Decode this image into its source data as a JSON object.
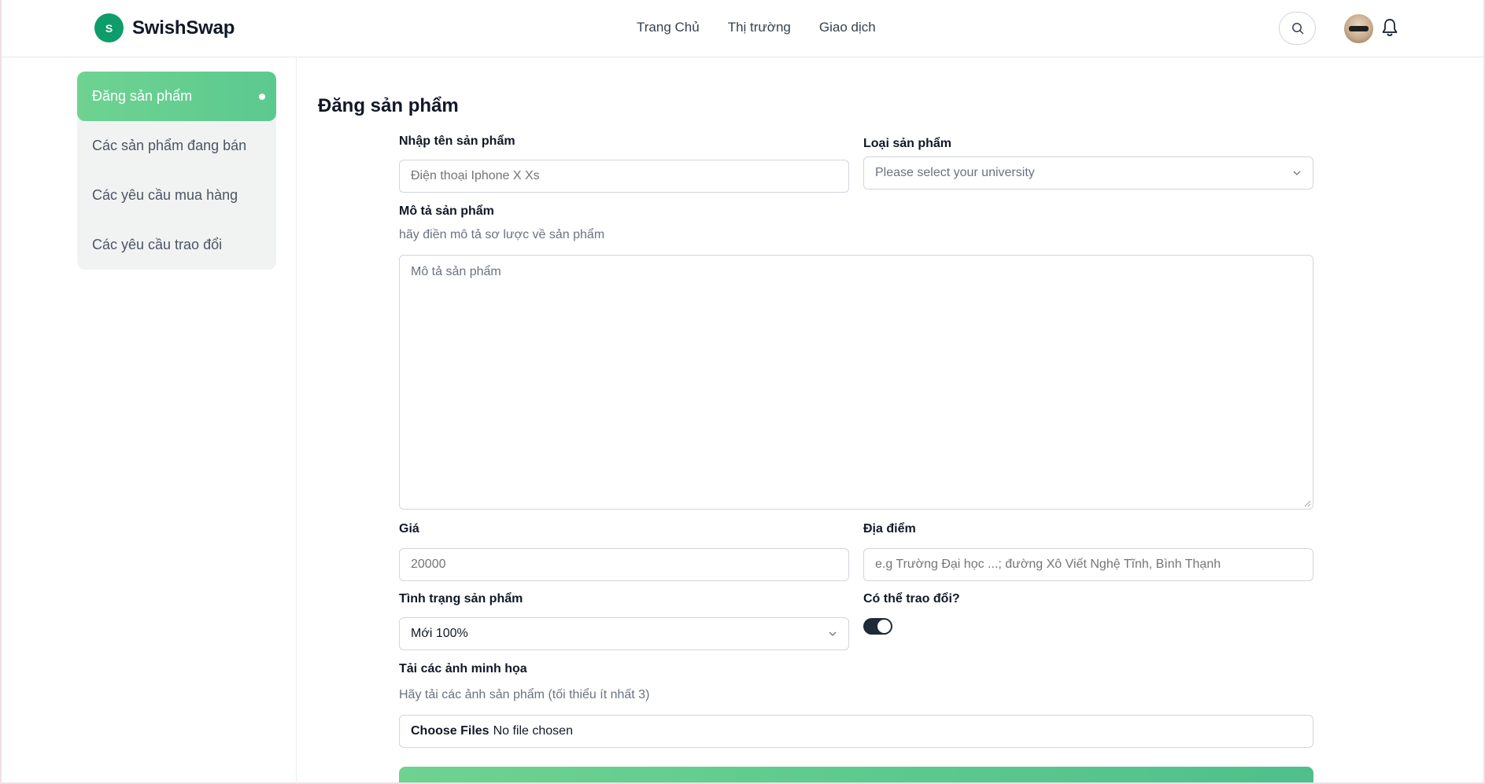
{
  "header": {
    "brand": "SwishSwap",
    "logo_letter": "S",
    "nav": [
      "Trang Chủ",
      "Thị trường",
      "Giao dịch"
    ]
  },
  "sidebar": {
    "items": [
      {
        "label": "Đăng sản phẩm",
        "active": true
      },
      {
        "label": "Các sản phẩm đang bán",
        "active": false
      },
      {
        "label": "Các yêu cầu mua hàng",
        "active": false
      },
      {
        "label": "Các yêu cầu trao đổi",
        "active": false
      }
    ]
  },
  "form": {
    "title": "Đăng sản phẩm",
    "name_label": "Nhập tên sản phẩm",
    "name_placeholder": "Điện thoại Iphone X Xs",
    "type_label": "Loại sản phẩm",
    "type_placeholder": "Please select your university",
    "desc_label": "Mô tả sản phẩm",
    "desc_hint": "hãy điền mô tả sơ lược về sản phẩm",
    "desc_placeholder": "Mô tả sản phẩm",
    "price_label": "Giá",
    "price_placeholder": "20000",
    "location_label": "Địa điểm",
    "location_placeholder": "e.g Trường Đại học ...; đường Xô Viết Nghệ Tĩnh, Bình Thạnh",
    "condition_label": "Tình trạng sản phẩm",
    "condition_value": "Mới 100%",
    "exchange_label": "Có thể trao đổi?",
    "exchange_enabled": true,
    "images_label": "Tải các ảnh minh họa",
    "images_hint": "Hãy tải các ảnh sản phẩm (tối thiểu ít nhất 3)",
    "file_button": "Choose Files",
    "file_status": "No file chosen"
  },
  "colors": {
    "accent": "#5cc990",
    "brand": "#0d9c6a"
  }
}
